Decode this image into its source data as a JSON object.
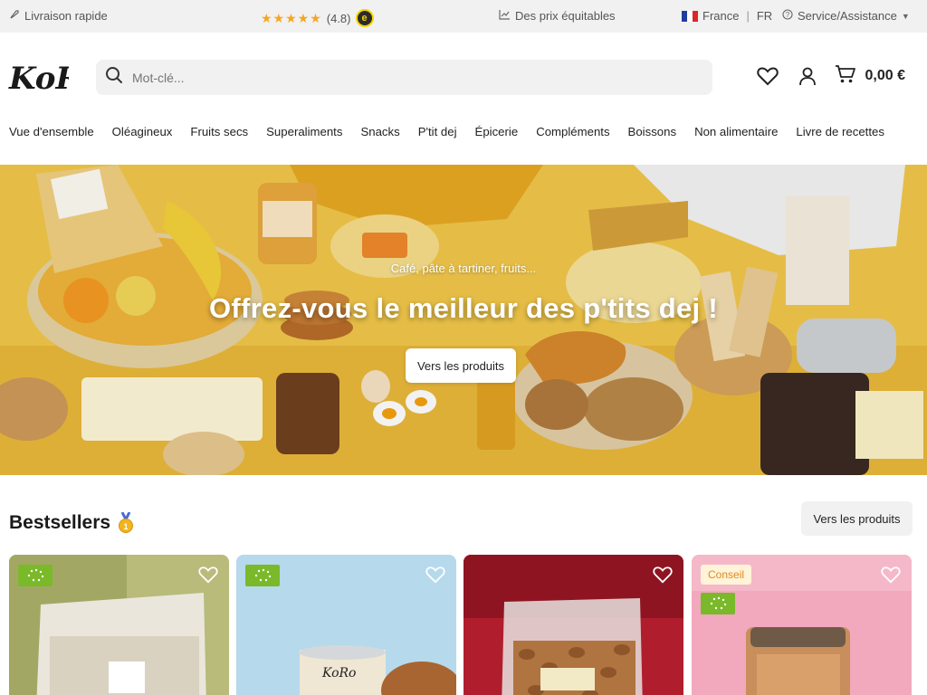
{
  "topbar": {
    "delivery": "Livraison rapide",
    "rating": "(4.8)",
    "badge": "e",
    "prices": "Des prix équitables",
    "country": "France",
    "lang": "FR",
    "service": "Service/Assistance"
  },
  "header": {
    "logo_text": "KoRo",
    "search_placeholder": "Mot-clé...",
    "cart_total": "0,00 €"
  },
  "nav": {
    "items": [
      "Vue d'ensemble",
      "Oléagineux",
      "Fruits secs",
      "Superaliments",
      "Snacks",
      "P'tit dej",
      "Épicerie",
      "Compléments",
      "Boissons",
      "Non alimentaire",
      "Livre de recettes"
    ]
  },
  "hero": {
    "subtitle": "Café, pâte à tartiner, fruits...",
    "title": "Offrez-vous le meilleur des p'tits dej !",
    "button": "Vers les produits"
  },
  "bestsellers": {
    "title": "Bestsellers",
    "button": "Vers les produits",
    "cards": [
      {
        "badge": ""
      },
      {
        "badge": ""
      },
      {
        "badge": ""
      },
      {
        "badge": "Conseil"
      }
    ]
  },
  "colors": {
    "accent_yellow": "#f1c63f",
    "organic_green": "#7ab929",
    "star": "#f5a623"
  }
}
